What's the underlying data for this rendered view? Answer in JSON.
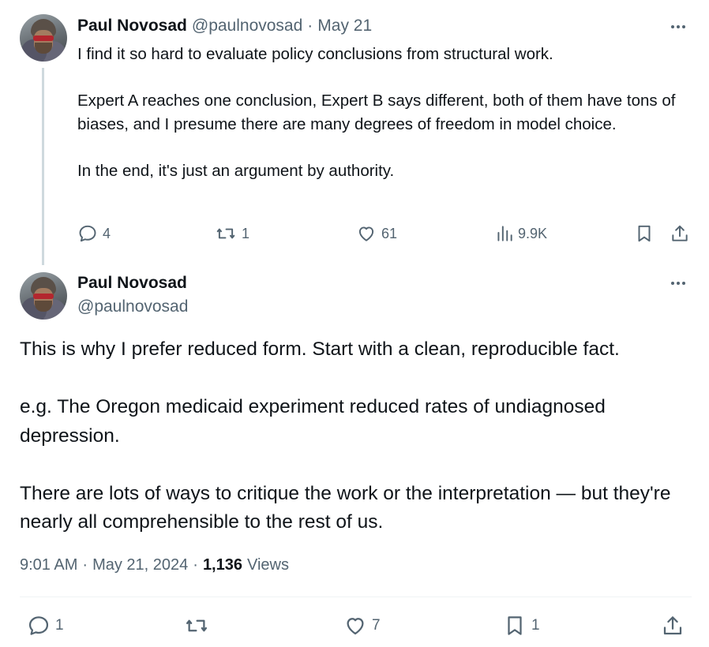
{
  "tweet1": {
    "author_name": "Paul Novosad",
    "author_handle": "@paulnovosad",
    "separator": "·",
    "date": "May 21",
    "paragraphs": [
      "I find it so hard to evaluate policy conclusions from structural work.",
      "Expert A reaches one conclusion, Expert B says different, both of them have tons of biases, and I presume there are many degrees of freedom in model choice.",
      "In the end, it's just an argument by authority."
    ],
    "replies": "4",
    "retweets": "1",
    "likes": "61",
    "views": "9.9K"
  },
  "tweet2": {
    "author_name": "Paul Novosad",
    "author_handle": "@paulnovosad",
    "paragraphs": [
      "This is why I prefer reduced form. Start with a clean, reproducible fact.",
      "e.g. The Oregon medicaid experiment reduced rates of undiagnosed depression.",
      "There are lots of ways to critique the work or the interpretation — but they're nearly all comprehensible to the rest of us."
    ],
    "time": "9:01 AM",
    "separator": "·",
    "full_date": "May 21, 2024",
    "view_count": "1,136",
    "views_label": "Views",
    "replies": "1",
    "likes": "7",
    "bookmarks": "1"
  },
  "colors": {
    "text": "#0f1419",
    "secondary": "#536471",
    "thread_line": "#cfd9de",
    "divider": "#eff3f4"
  },
  "icons": [
    "reply-icon",
    "retweet-icon",
    "like-icon",
    "views-icon",
    "bookmark-icon",
    "share-icon",
    "more-icon"
  ]
}
